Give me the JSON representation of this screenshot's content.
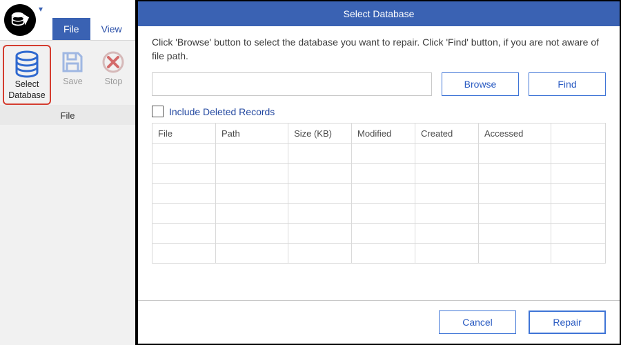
{
  "ribbon": {
    "tabs": {
      "file": "File",
      "view": "View"
    },
    "items": {
      "select_db": {
        "line1": "Select",
        "line2": "Database"
      },
      "save": "Save",
      "stop": "Stop"
    },
    "group_label": "File"
  },
  "dialog": {
    "title": "Select Database",
    "instruction": "Click 'Browse' button to select the database you want to repair. Click 'Find' button, if you are not aware of file path.",
    "path_value": "",
    "browse": "Browse",
    "find": "Find",
    "include_deleted": "Include Deleted Records",
    "columns": {
      "file": "File",
      "path": "Path",
      "size": "Size (KB)",
      "modified": "Modified",
      "created": "Created",
      "accessed": "Accessed"
    },
    "footer": {
      "cancel": "Cancel",
      "repair": "Repair"
    }
  }
}
